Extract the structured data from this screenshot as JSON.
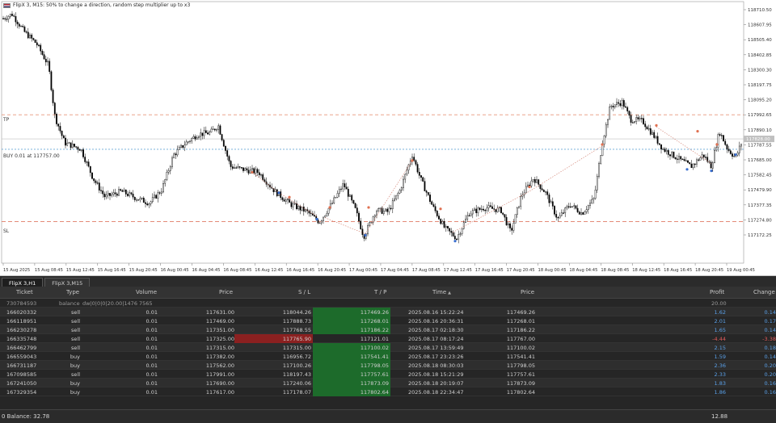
{
  "chart": {
    "title": "FlipX 3, M15:  50% to change a direction, random step multiplier up to x3",
    "y_ticks": [
      "118710.50",
      "118607.95",
      "118505.40",
      "118402.85",
      "118300.30",
      "118197.75",
      "118095.20",
      "117992.65",
      "117890.10",
      "117787.55",
      "117685.00",
      "117582.45",
      "117479.90",
      "117377.35",
      "117274.80",
      "117172.25"
    ],
    "x_ticks": [
      "15 Aug 2025",
      "15 Aug 08:45",
      "15 Aug 12:45",
      "15 Aug 16:45",
      "15 Aug 20:45",
      "16 Aug 00:45",
      "16 Aug 04:45",
      "16 Aug 08:45",
      "16 Aug 12:45",
      "16 Aug 16:45",
      "16 Aug 20:45",
      "17 Aug 00:45",
      "17 Aug 04:45",
      "17 Aug 08:45",
      "17 Aug 12:45",
      "17 Aug 16:45",
      "17 Aug 20:45",
      "18 Aug 00:45",
      "18 Aug 04:45",
      "18 Aug 08:45",
      "18 Aug 12:45",
      "18 Aug 16:45",
      "18 Aug 20:45",
      "19 Aug 00:45"
    ],
    "current_price": "117828.00",
    "tp_label": "TP",
    "buy_label": "BUY 0.01 at 117757.00",
    "sl_label": "SL",
    "tp_price": 117992.65,
    "buy_price": 117757.0,
    "sl_price": 117263.0,
    "colors": {
      "tp": "#e8967a",
      "buy": "#6aa6d6",
      "sl": "#e07a66",
      "candle": "#000000"
    }
  },
  "tabs": [
    "FlipX 3,H1",
    "FlipX 3,M15"
  ],
  "table": {
    "headers": {
      "ticket": "Ticket",
      "type": "Type",
      "volume": "Volume",
      "price": "Price",
      "sl": "S / L",
      "tp": "T / P",
      "time": "Time",
      "price2": "Price",
      "profit": "Profit",
      "change": "Change"
    },
    "balance_row": {
      "ticket": "730784593",
      "type": "balance",
      "comment": "dw|0|0|0|20.00|1476 7565",
      "profit": "20.00"
    },
    "rows": [
      {
        "ticket": "166020332",
        "type": "sell",
        "volume": "0.01",
        "price": "117631.00",
        "sl": "118044.26",
        "tp": "117469.26",
        "time": "2025.08.16 15:22:24",
        "price2": "117469.26",
        "profit": "1.62",
        "change": "0.14",
        "sl_hit": false,
        "tp_hit": true
      },
      {
        "ticket": "166118951",
        "type": "sell",
        "volume": "0.01",
        "price": "117469.00",
        "sl": "117888.73",
        "tp": "117268.01",
        "time": "2025.08.16 20:36:31",
        "price2": "117268.01",
        "profit": "2.01",
        "change": "0.17",
        "sl_hit": false,
        "tp_hit": true
      },
      {
        "ticket": "166230278",
        "type": "sell",
        "volume": "0.01",
        "price": "117351.00",
        "sl": "117768.55",
        "tp": "117186.22",
        "time": "2025.08.17 02:18:30",
        "price2": "117186.22",
        "profit": "1.65",
        "change": "0.14",
        "sl_hit": false,
        "tp_hit": true
      },
      {
        "ticket": "166335748",
        "type": "sell",
        "volume": "0.01",
        "price": "117325.00",
        "sl": "117765.90",
        "tp": "117121.01",
        "time": "2025.08.17 08:17:24",
        "price2": "117767.00",
        "profit": "-4.44",
        "change": "-3.38",
        "sl_hit": true,
        "tp_hit": false
      },
      {
        "ticket": "166462799",
        "type": "sell",
        "volume": "0.01",
        "price": "117315.00",
        "sl": "117315.00",
        "tp": "117100.02",
        "time": "2025.08.17 13:59:49",
        "price2": "117100.02",
        "profit": "2.15",
        "change": "0.18",
        "sl_hit": false,
        "tp_hit": true
      },
      {
        "ticket": "166559043",
        "type": "buy",
        "volume": "0.01",
        "price": "117382.00",
        "sl": "116956.72",
        "tp": "117541.41",
        "time": "2025.08.17 23:23:26",
        "price2": "117541.41",
        "profit": "1.59",
        "change": "0.14",
        "sl_hit": false,
        "tp_hit": true
      },
      {
        "ticket": "166731187",
        "type": "buy",
        "volume": "0.01",
        "price": "117562.00",
        "sl": "117100.26",
        "tp": "117798.05",
        "time": "2025.08.18 08:30:03",
        "price2": "117798.05",
        "profit": "2.36",
        "change": "0.20",
        "sl_hit": false,
        "tp_hit": true
      },
      {
        "ticket": "167098585",
        "type": "sell",
        "volume": "0.01",
        "price": "117991.00",
        "sl": "118197.43",
        "tp": "117757.61",
        "time": "2025.08.18 15:21:29",
        "price2": "117757.61",
        "profit": "2.33",
        "change": "0.20",
        "sl_hit": false,
        "tp_hit": true
      },
      {
        "ticket": "167241050",
        "type": "buy",
        "volume": "0.01",
        "price": "117690.00",
        "sl": "117240.06",
        "tp": "117873.09",
        "time": "2025.08.18 20:19:07",
        "price2": "117873.09",
        "profit": "1.83",
        "change": "0.16",
        "sl_hit": false,
        "tp_hit": true
      },
      {
        "ticket": "167329354",
        "type": "buy",
        "volume": "0.01",
        "price": "117617.00",
        "sl": "117178.07",
        "tp": "117802.64",
        "time": "2025.08.18 22:34:47",
        "price2": "117802.64",
        "profit": "1.86",
        "change": "0.16",
        "sl_hit": false,
        "tp_hit": true
      }
    ]
  },
  "status": {
    "balance": "0  Balance: 32.78",
    "total": "12.88"
  }
}
